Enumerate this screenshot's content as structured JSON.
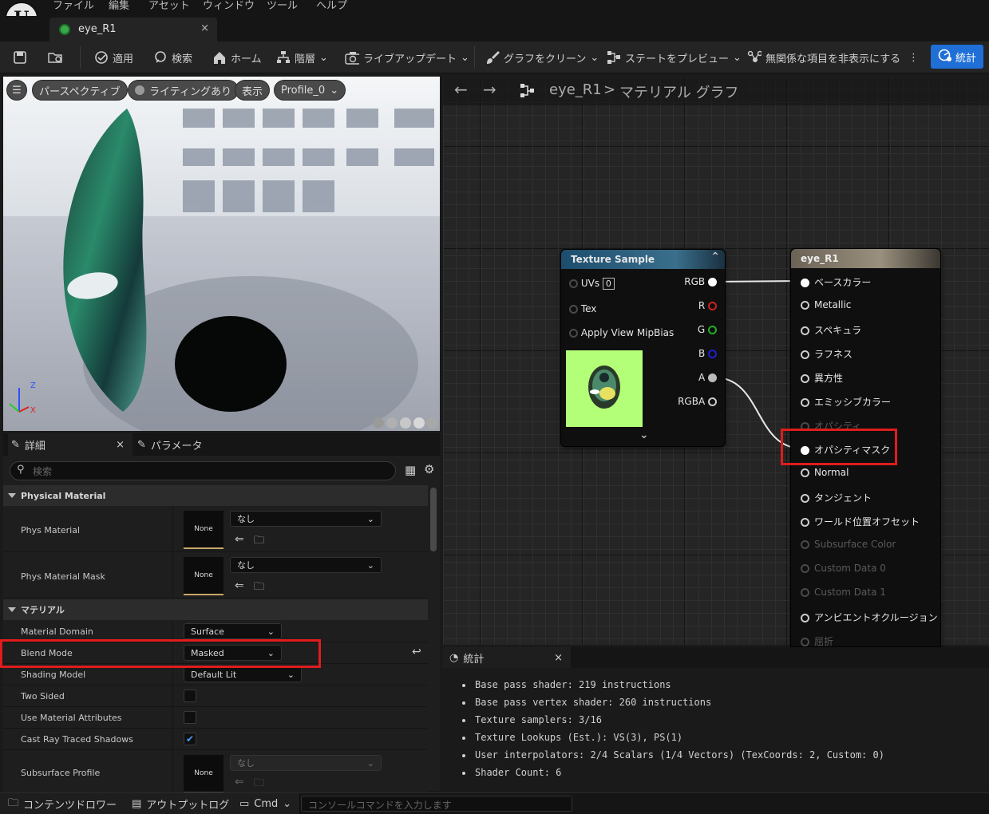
{
  "menu": [
    "ファイル",
    "編集",
    "アセット",
    "ウィンドウ",
    "ツール",
    "ヘルプ"
  ],
  "tab": {
    "title": "eye_R1",
    "close": "×"
  },
  "toolbar": {
    "apply": "適用",
    "search": "検索",
    "home": "ホーム",
    "hierarchy": "階層",
    "live_update": "ライブアップデート",
    "clean_graph": "グラフをクリーン",
    "preview_state": "ステートをプレビュー",
    "hide_unrelated": "無関係な項目を非表示にする",
    "stats": "統計"
  },
  "viewport": {
    "perspective": "パースペクティブ",
    "lighting": "ライティングあり",
    "show": "表示",
    "profile": "Profile_0",
    "axis_z": "Z",
    "axis_x": "X"
  },
  "details": {
    "tab_details": "詳細",
    "tab_params": "パラメータ",
    "close": "×",
    "search_placeholder": "検索",
    "section_physical": "Physical Material",
    "phys_material": "Phys Material",
    "phys_material_mask": "Phys Material Mask",
    "none_thumb": "None",
    "none_value": "なし",
    "section_material": "マテリアル",
    "material_domain": "Material Domain",
    "material_domain_value": "Surface",
    "blend_mode": "Blend Mode",
    "blend_mode_value": "Masked",
    "shading_model": "Shading Model",
    "shading_model_value": "Default Lit",
    "two_sided": "Two Sided",
    "use_material_attributes": "Use Material Attributes",
    "cast_ray_traced_shadows": "Cast Ray Traced Shadows",
    "subsurface_profile": "Subsurface Profile"
  },
  "graph": {
    "breadcrumb_asset": "eye_R1",
    "breadcrumb_sep": ">",
    "breadcrumb_graph": "マテリアル グラフ",
    "texture_node": {
      "title": "Texture Sample",
      "uvs": "UVs",
      "uvs_value": "0",
      "tex": "Tex",
      "mipbias": "Apply View MipBias",
      "outputs": [
        "RGB",
        "R",
        "G",
        "B",
        "A",
        "RGBA"
      ]
    },
    "material_node": {
      "title": "eye_R1",
      "inputs": [
        {
          "label": "ベースカラー",
          "state": "connected"
        },
        {
          "label": "Metallic",
          "state": "active"
        },
        {
          "label": "スペキュラ",
          "state": "active"
        },
        {
          "label": "ラフネス",
          "state": "active"
        },
        {
          "label": "異方性",
          "state": "active"
        },
        {
          "label": "エミッシブカラー",
          "state": "active"
        },
        {
          "label": "オパシティ",
          "state": "disabled"
        },
        {
          "label": "オパシティマスク",
          "state": "connected"
        },
        {
          "label": "Normal",
          "state": "active"
        },
        {
          "label": "タンジェント",
          "state": "active"
        },
        {
          "label": "ワールド位置オフセット",
          "state": "active"
        },
        {
          "label": "Subsurface Color",
          "state": "disabled"
        },
        {
          "label": "Custom Data 0",
          "state": "disabled"
        },
        {
          "label": "Custom Data 1",
          "state": "disabled"
        },
        {
          "label": "アンビエントオクルージョン",
          "state": "active"
        },
        {
          "label": "屈折",
          "state": "disabled"
        }
      ]
    }
  },
  "stats": {
    "title": "統計",
    "close": "×",
    "lines": [
      "Base pass shader: 219 instructions",
      "Base pass vertex shader: 260 instructions",
      "Texture samplers: 3/16",
      "Texture Lookups (Est.): VS(3), PS(1)",
      "User interpolators: 2/4 Scalars (1/4 Vectors) (TexCoords: 2, Custom: 0)",
      "Shader Count: 6"
    ]
  },
  "bottom": {
    "content_drawer": "コンテンツドロワー",
    "output_log": "アウトプットログ",
    "cmd": "Cmd",
    "console_placeholder": "コンソールコマンドを入力します"
  },
  "colors": {
    "accent": "#1f6fd6",
    "highlight": "#e01c1c",
    "pin_red": "#d02020",
    "pin_green": "#20b020",
    "pin_blue": "#2020d0"
  }
}
